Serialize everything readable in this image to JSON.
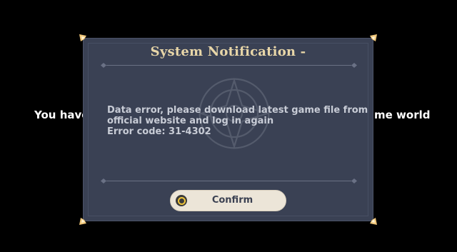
{
  "background": {
    "left_text": "You have",
    "right_text": "me world"
  },
  "dialog": {
    "title": "System Notification -",
    "message_lines": [
      "Data error, please download latest game file from",
      "official website and log in again",
      "Error code: 31-4302"
    ],
    "confirm_label": "Confirm"
  },
  "colors": {
    "panel": "#3a4154",
    "title": "#e8d6a8",
    "message": "#c8ccd6",
    "button": "#ece5d8",
    "button_text": "#3b4152",
    "button_icon_ring": "#f0c53a",
    "corner_ornament": "#f0c77a"
  },
  "icons": {
    "corner": "corner-ornament-icon",
    "emblem": "emblem-watermark-icon",
    "confirm": "confirm-circle-icon"
  }
}
